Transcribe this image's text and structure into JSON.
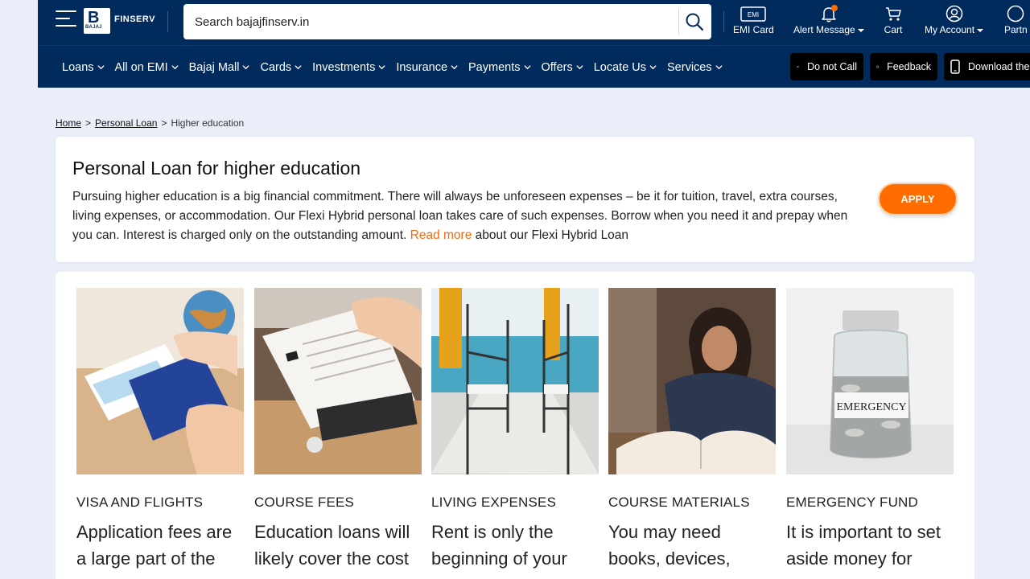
{
  "header": {
    "logo_text": "FINSERV",
    "logo_letter": "B",
    "logo_sub": "BAJAJ",
    "search_placeholder": "Search bajajfinserv.in",
    "icon_items": [
      {
        "label": "EMI Card",
        "icon": "emi-card-icon"
      },
      {
        "label": "Alert Message",
        "icon": "bell-icon"
      },
      {
        "label": "Cart",
        "icon": "cart-icon"
      },
      {
        "label": "My Account",
        "icon": "user-icon"
      },
      {
        "label": "Partn",
        "icon": "partner-icon"
      }
    ],
    "emi_card_badge": "EMI"
  },
  "nav": {
    "items": [
      "Loans",
      "All on EMI",
      "Bajaj Mall",
      "Cards",
      "Investments",
      "Insurance",
      "Payments",
      "Offers",
      "Locate Us",
      "Services"
    ],
    "pills": [
      "Do not Call",
      "Feedback",
      "Download the"
    ]
  },
  "breadcrumb": {
    "home": "Home",
    "personal_loan": "Personal Loan",
    "current": "Higher education",
    "separator": ">"
  },
  "intro": {
    "title": "Personal Loan for higher education",
    "body": "Pursuing higher education is a big financial commitment. There will always be unforeseen expenses – be it for tuition, travel, extra courses, living expenses, or accommodation. Our Flexi Hybrid personal loan takes care of such expenses. Borrow when you need it and prepay when you can. Interest is charged only on the outstanding amount. ",
    "read_more": "Read more",
    "body_tail": " about our Flexi Hybrid Loan",
    "apply_label": "APPLY"
  },
  "cards": [
    {
      "category": "VISA AND FLIGHTS",
      "text": "Application fees are a large part of the"
    },
    {
      "category": "COURSE FEES",
      "text": "Education loans will likely cover the cost"
    },
    {
      "category": "LIVING EXPENSES",
      "text": "Rent is only the beginning of your"
    },
    {
      "category": "COURSE MATERIALS",
      "text": "You may need books, devices,"
    },
    {
      "category": "EMERGENCY FUND",
      "text": "It is important to set aside money for",
      "jar_label": "EMERGENCY"
    }
  ],
  "colors": {
    "header_bg": "#002b5c",
    "accent_orange": "#ff6d00",
    "link_orange": "#ef6b12",
    "page_bg": "#e9eef8"
  }
}
